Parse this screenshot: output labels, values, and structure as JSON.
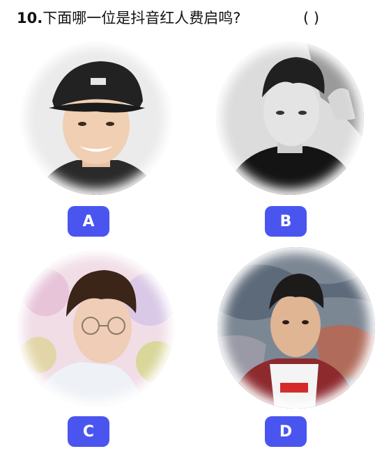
{
  "question": {
    "number": "10.",
    "text": "下面哪一位是抖音红人费启鸣?",
    "blank": "(      )"
  },
  "options": [
    {
      "label": "A",
      "icon": "portrait-photo-black-cap"
    },
    {
      "label": "B",
      "icon": "portrait-photo-grayscale"
    },
    {
      "label": "C",
      "icon": "portrait-photo-glasses-flowers"
    },
    {
      "label": "D",
      "icon": "portrait-photo-graffiti-wall"
    }
  ],
  "colors": {
    "button": "#4a55f0",
    "button_text": "#ffffff"
  }
}
